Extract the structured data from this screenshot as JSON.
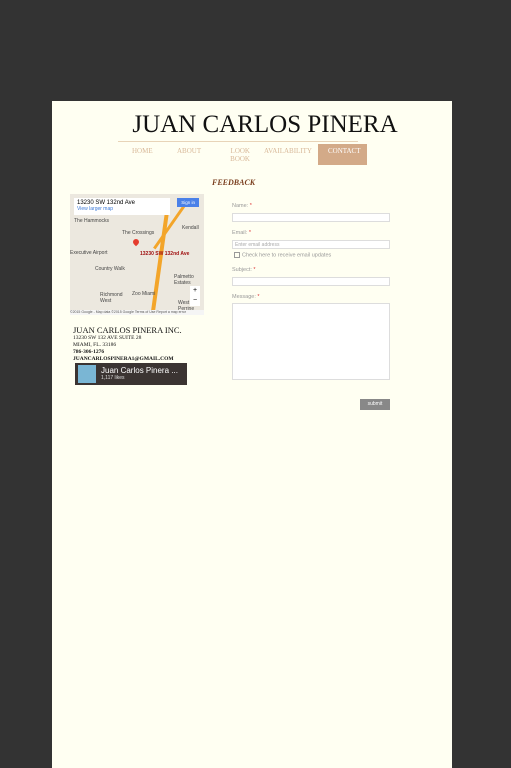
{
  "site": {
    "title": "JUAN CARLOS PINERA"
  },
  "nav": [
    {
      "label": "HOME"
    },
    {
      "label": "ABOUT"
    },
    {
      "label": "LOOK BOOK"
    },
    {
      "label": "AVAILABILITY"
    },
    {
      "label": "CONTACT"
    }
  ],
  "section_title": "FEEDBACK",
  "map": {
    "address": "13230 SW 132nd Ave",
    "link": "View larger map",
    "signin": "Sign in",
    "pin_label": "13230 SW 132nd Ave",
    "places": [
      "The Hammocks",
      "The Crossings",
      "Kendall",
      "Executive Airport",
      "Country Walk",
      "Richmond West",
      "Zoo Miami",
      "Palmetto Estates",
      "West Perrine"
    ],
    "footer": "©2015 Google - Map data ©2015 Google  Terms of Use  Report a map error",
    "zoom_in": "+",
    "zoom_out": "−"
  },
  "contact": {
    "name": "JUAN CARLOS PINERA INC.",
    "street": "13230 SW 132 AVE SUITE 28",
    "city": "MIAMI, FL. 33186",
    "phone": "786-306-1276",
    "email": "JUANCARLOSPINERA1@GMAIL.COM"
  },
  "facebook": {
    "title": "Juan Carlos Pinera ...",
    "likes": "1,117 likes"
  },
  "form": {
    "name_label": "Name:",
    "email_label": "Email:",
    "email_placeholder": "Enter email address",
    "updates_label": "Check here to receive email updates",
    "subject_label": "Subject:",
    "message_label": "Message:",
    "required": "*",
    "submit": "submit"
  }
}
